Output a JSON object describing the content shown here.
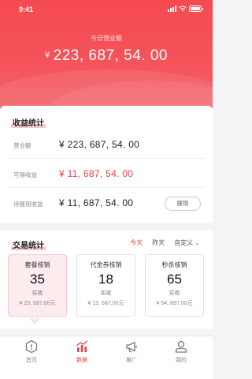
{
  "status_bar": {
    "time": "9:41"
  },
  "hero": {
    "label": "今日营业额",
    "currency": "¥",
    "value": "223, 687, 54. 00"
  },
  "income": {
    "title": "收益统计",
    "rows": [
      {
        "label": "营业额",
        "value": "¥ 223, 687, 54. 00"
      },
      {
        "label": "可得收益",
        "value": "¥ 11, 687, 54. 00"
      },
      {
        "label": "待提现收益",
        "value": "¥ 11, 687, 54. 00"
      }
    ],
    "withdraw_label": "提现"
  },
  "trade": {
    "title": "交易统计",
    "tabs": [
      "今天",
      "昨天",
      "自定义"
    ],
    "stats": [
      {
        "title": "套餐核销",
        "count": "35",
        "sub": "实收",
        "amount": "¥ 23, 687.00元"
      },
      {
        "title": "代金券核销",
        "count": "18",
        "sub": "实收",
        "amount": "¥ 13, 687.00元"
      },
      {
        "title": "秒杀核销",
        "count": "65",
        "sub": "实收",
        "amount": "¥ 54, 687.00元"
      }
    ]
  },
  "tabbar": {
    "items": [
      {
        "label": "首页",
        "icon": "home-icon"
      },
      {
        "label": "数据",
        "icon": "chart-icon"
      },
      {
        "label": "推广",
        "icon": "megaphone-icon"
      },
      {
        "label": "我的",
        "icon": "user-icon"
      }
    ]
  },
  "colors": {
    "accent": "#e8424a",
    "hero_top": "#f64a52",
    "highlight": "#f8c8cc"
  }
}
